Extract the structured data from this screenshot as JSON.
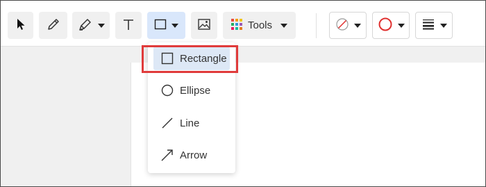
{
  "toolbar": {
    "tools_label": "Tools",
    "buttons": [
      {
        "name": "select",
        "icon": "pointer-arrow-icon"
      },
      {
        "name": "pen",
        "icon": "pencil-icon"
      },
      {
        "name": "highlighter",
        "icon": "highlighter-icon"
      },
      {
        "name": "text",
        "icon": "text-icon"
      },
      {
        "name": "shapes",
        "icon": "rectangle-shape-icon",
        "active": true
      },
      {
        "name": "image",
        "icon": "image-icon"
      },
      {
        "name": "tools",
        "icon": "color-grid-icon"
      },
      {
        "name": "fill-color",
        "icon": "no-fill-icon"
      },
      {
        "name": "stroke-color",
        "icon": "stroke-circle-icon",
        "color": "#e0302f"
      },
      {
        "name": "line-weight",
        "icon": "line-weight-icon"
      }
    ]
  },
  "shapes_menu": {
    "items": [
      {
        "label": "Rectangle",
        "icon": "rectangle-icon",
        "selected": true
      },
      {
        "label": "Ellipse",
        "icon": "ellipse-icon"
      },
      {
        "label": "Line",
        "icon": "line-icon"
      },
      {
        "label": "Arrow",
        "icon": "arrow-icon"
      }
    ]
  },
  "colors": {
    "highlight_border": "#e03b3b",
    "active_button": "#d9e7fb",
    "selected_item": "#dde8f6",
    "stroke_color": "#e0302f"
  }
}
